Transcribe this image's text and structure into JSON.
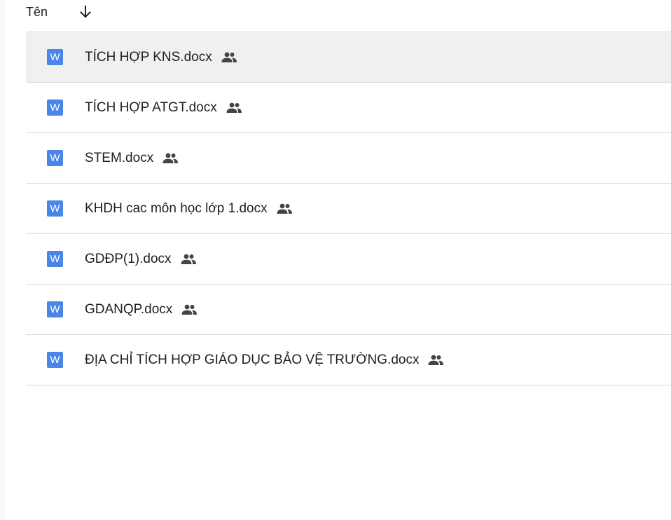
{
  "header": {
    "column_label": "Tên",
    "sort_icon": "arrow-down-icon"
  },
  "files": [
    {
      "name": "TÍCH HỢP KNS.docx",
      "type_icon": "word-icon",
      "type_letter": "W",
      "shared_icon": "shared-people-icon",
      "selected": true
    },
    {
      "name": "TÍCH HỢP ATGT.docx",
      "type_icon": "word-icon",
      "type_letter": "W",
      "shared_icon": "shared-people-icon",
      "selected": false
    },
    {
      "name": "STEM.docx",
      "type_icon": "word-icon",
      "type_letter": "W",
      "shared_icon": "shared-people-icon",
      "selected": false
    },
    {
      "name": "KHDH cac môn học lớp 1.docx",
      "type_icon": "word-icon",
      "type_letter": "W",
      "shared_icon": "shared-people-icon",
      "selected": false
    },
    {
      "name": "GDĐP(1).docx",
      "type_icon": "word-icon",
      "type_letter": "W",
      "shared_icon": "shared-people-icon",
      "selected": false
    },
    {
      "name": "GDANQP.docx",
      "type_icon": "word-icon",
      "type_letter": "W",
      "shared_icon": "shared-people-icon",
      "selected": false
    },
    {
      "name": "ĐỊA CHỈ TÍCH HỢP GIÁO DỤC BẢO VỆ TRƯỜNG.docx",
      "type_icon": "word-icon",
      "type_letter": "W",
      "shared_icon": "shared-people-icon",
      "selected": false
    }
  ],
  "colors": {
    "word_blue": "#4a86e8",
    "selected_row": "#f0f0f0",
    "divider": "#d9d9d9",
    "text": "#1f1f1f"
  }
}
